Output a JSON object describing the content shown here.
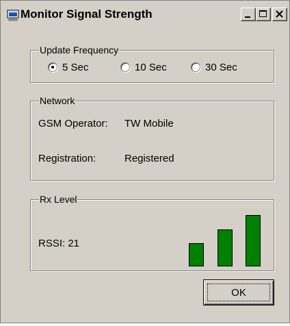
{
  "window": {
    "title": "Monitor Signal Strength"
  },
  "titlebar_buttons": {
    "minimize": "minimize-icon",
    "maximize": "maximize-icon",
    "close": "close-icon"
  },
  "update_frequency": {
    "legend": "Update Frequency",
    "options": [
      {
        "label": "5 Sec",
        "checked": true
      },
      {
        "label": "10 Sec",
        "checked": false
      },
      {
        "label": "30 Sec",
        "checked": false
      }
    ]
  },
  "network": {
    "legend": "Network",
    "operator_label": "GSM Operator:",
    "operator_value": "TW Mobile",
    "registration_label": "Registration:",
    "registration_value": "Registered"
  },
  "rx_level": {
    "legend": "Rx Level",
    "rssi_text": "RSSI: 21",
    "bars_color": "#008000",
    "bars_shown": 3
  },
  "ok_button": {
    "label": "OK"
  }
}
